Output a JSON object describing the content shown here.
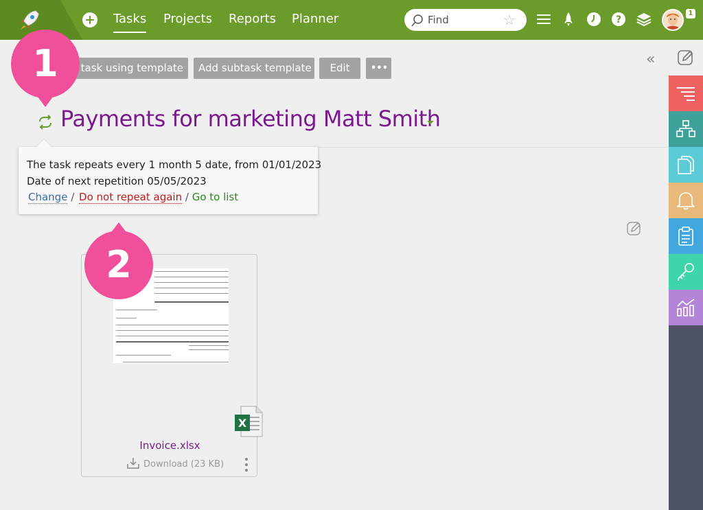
{
  "nav": {
    "items": [
      "Tasks",
      "Projects",
      "Reports",
      "Planner"
    ],
    "active": "Tasks"
  },
  "search": {
    "placeholder": "Find"
  },
  "user": {
    "badge": "1"
  },
  "toolbar": {
    "buttons": [
      "Add task using template",
      "Add subtask template",
      "Edit",
      "•••"
    ]
  },
  "callouts": [
    "1",
    "2"
  ],
  "task": {
    "title": "Payments for marketing Matt Smith"
  },
  "repeat_popup": {
    "line1": "The task repeats every 1 month 5 date, from 01/01/2023",
    "line2": "Date of next repetition 05/05/2023",
    "change": "Change",
    "sep1": " / ",
    "stop": "Do not repeat again",
    "sep2": " / ",
    "list": "Go to list"
  },
  "attachment": {
    "file_name": "Invoice.xlsx",
    "download_label": "Download",
    "size": "(23 KB)"
  },
  "colors": {
    "topbar": "#6b9b2a",
    "title": "#7a1a8e",
    "callout": "#f0509a",
    "sidebar": [
      "#4e5366",
      "#ee6262",
      "#3ea29a",
      "#5ccbd7",
      "#e8b97a",
      "#41a7dd",
      "#3fd5ab",
      "#b384d8"
    ]
  }
}
